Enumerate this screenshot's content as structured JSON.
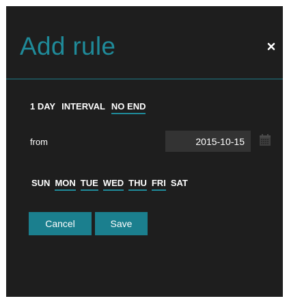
{
  "dialog": {
    "title": "Add rule",
    "close_icon": "close-icon",
    "accent_color": "#1f8a99",
    "background_color": "#1e1e1e"
  },
  "recurrence": {
    "options": [
      {
        "label": "1 DAY",
        "selected": false
      },
      {
        "label": "INTERVAL",
        "selected": false
      },
      {
        "label": "NO END",
        "selected": true
      }
    ]
  },
  "from": {
    "label": "from",
    "date_value": "2015-10-15",
    "calendar_icon": "calendar-icon"
  },
  "weekdays": [
    {
      "label": "SUN",
      "selected": false
    },
    {
      "label": "MON",
      "selected": true
    },
    {
      "label": "TUE",
      "selected": true
    },
    {
      "label": "WED",
      "selected": true
    },
    {
      "label": "THU",
      "selected": true
    },
    {
      "label": "FRI",
      "selected": true
    },
    {
      "label": "SAT",
      "selected": false
    }
  ],
  "buttons": {
    "cancel_label": "Cancel",
    "save_label": "Save"
  }
}
